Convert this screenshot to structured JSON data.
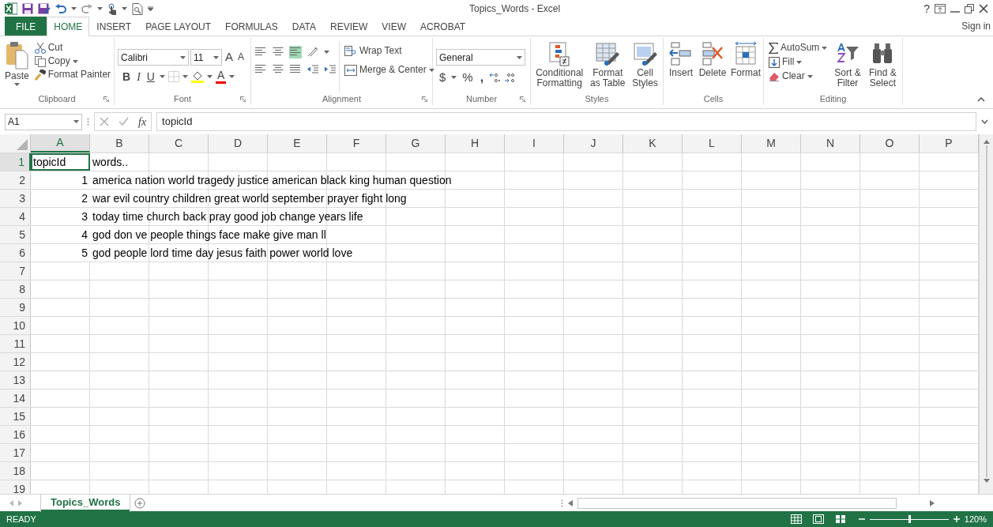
{
  "window": {
    "title": "Topics_Words - Excel",
    "help": "?",
    "sign_in": "Sign in"
  },
  "ribbon_tabs": [
    {
      "label": "FILE",
      "kind": "file"
    },
    {
      "label": "HOME",
      "kind": "tab",
      "selected": true
    },
    {
      "label": "INSERT",
      "kind": "tab",
      "selected": false
    },
    {
      "label": "PAGE LAYOUT",
      "kind": "tab",
      "selected": false
    },
    {
      "label": "FORMULAS",
      "kind": "tab",
      "selected": false
    },
    {
      "label": "DATA",
      "kind": "tab",
      "selected": false
    },
    {
      "label": "REVIEW",
      "kind": "tab",
      "selected": false
    },
    {
      "label": "VIEW",
      "kind": "tab",
      "selected": false
    },
    {
      "label": "ACROBAT",
      "kind": "tab",
      "selected": false
    }
  ],
  "clipboard": {
    "label": "Clipboard",
    "paste": "Paste",
    "cut": "Cut",
    "copy": "Copy",
    "format_painter": "Format Painter"
  },
  "font": {
    "label": "Font",
    "name": "Calibri",
    "size": "11",
    "grow": "A",
    "shrink": "A",
    "bold": "B",
    "italic": "I",
    "underline": "U",
    "font_color": "A"
  },
  "alignment": {
    "label": "Alignment",
    "wrap_text": "Wrap Text",
    "merge": "Merge & Center"
  },
  "number": {
    "label": "Number",
    "format": "General",
    "currency": "$",
    "percent": "%",
    "comma": ","
  },
  "styles": {
    "label": "Styles",
    "conditional": "Conditional Formatting",
    "format_table": "Format as Table",
    "cell_styles": "Cell Styles"
  },
  "cells": {
    "label": "Cells",
    "insert": "Insert",
    "delete": "Delete",
    "format": "Format"
  },
  "editing": {
    "label": "Editing",
    "autosum": "AutoSum",
    "fill": "Fill",
    "clear": "Clear",
    "sort": "Sort & Filter",
    "find": "Find & Select"
  },
  "formula_bar": {
    "name_box": "A1",
    "fx": "fx",
    "content": "topicId"
  },
  "columns": [
    {
      "label": "A",
      "selected": true
    },
    {
      "label": "B",
      "selected": false
    },
    {
      "label": "C",
      "selected": false
    },
    {
      "label": "D",
      "selected": false
    },
    {
      "label": "E",
      "selected": false
    },
    {
      "label": "F",
      "selected": false
    },
    {
      "label": "G",
      "selected": false
    },
    {
      "label": "H",
      "selected": false
    },
    {
      "label": "I",
      "selected": false
    },
    {
      "label": "J",
      "selected": false
    },
    {
      "label": "K",
      "selected": false
    },
    {
      "label": "L",
      "selected": false
    },
    {
      "label": "M",
      "selected": false
    },
    {
      "label": "N",
      "selected": false
    },
    {
      "label": "O",
      "selected": false
    },
    {
      "label": "P",
      "selected": false
    }
  ],
  "rows": [
    {
      "number": "1",
      "selected": true,
      "cells": [
        {
          "text": "topicId",
          "kind": "text",
          "selected": true
        },
        {
          "text": "words..",
          "kind": "text",
          "selected": false
        }
      ]
    },
    {
      "number": "2",
      "selected": false,
      "cells": [
        {
          "text": "1",
          "kind": "number",
          "selected": false
        },
        {
          "text": "america nation world tragedy justice american black king human question",
          "kind": "text",
          "selected": false
        }
      ]
    },
    {
      "number": "3",
      "selected": false,
      "cells": [
        {
          "text": "2",
          "kind": "number",
          "selected": false
        },
        {
          "text": "war evil country children great world september prayer fight long",
          "kind": "text",
          "selected": false
        }
      ]
    },
    {
      "number": "4",
      "selected": false,
      "cells": [
        {
          "text": "3",
          "kind": "number",
          "selected": false
        },
        {
          "text": "today time church back pray good job change years life",
          "kind": "text",
          "selected": false
        }
      ]
    },
    {
      "number": "5",
      "selected": false,
      "cells": [
        {
          "text": "4",
          "kind": "number",
          "selected": false
        },
        {
          "text": "god don ve people things face make give man ll",
          "kind": "text",
          "selected": false
        }
      ]
    },
    {
      "number": "6",
      "selected": false,
      "cells": [
        {
          "text": "5",
          "kind": "number",
          "selected": false
        },
        {
          "text": "god people lord time day jesus faith power world love",
          "kind": "text",
          "selected": false
        }
      ]
    },
    {
      "number": "7",
      "selected": false
    },
    {
      "number": "8",
      "selected": false
    },
    {
      "number": "9",
      "selected": false
    },
    {
      "number": "10",
      "selected": false
    },
    {
      "number": "11",
      "selected": false
    },
    {
      "number": "12",
      "selected": false
    },
    {
      "number": "13",
      "selected": false
    },
    {
      "number": "14",
      "selected": false
    },
    {
      "number": "15",
      "selected": false
    },
    {
      "number": "16",
      "selected": false
    },
    {
      "number": "17",
      "selected": false
    },
    {
      "number": "18",
      "selected": false
    },
    {
      "number": "19",
      "selected": false
    }
  ],
  "sheet_tabs": [
    {
      "label": "Topics_Words",
      "selected": true
    }
  ],
  "status_bar": {
    "status": "READY",
    "zoom": "120%",
    "zoom_level": {
      "level": 0.5
    }
  }
}
